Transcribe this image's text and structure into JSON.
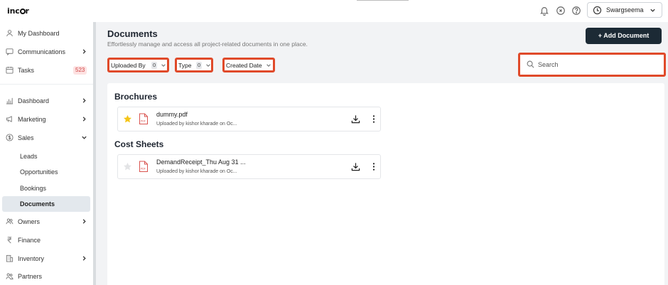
{
  "app": {
    "logo_text_left": "inc",
    "logo_text_right": "r"
  },
  "topbar": {
    "user_name": "Swargseema"
  },
  "sidebar": {
    "items": [
      {
        "label": "My Dashboard",
        "icon": "user-icon"
      },
      {
        "label": "Communications",
        "icon": "chat-icon"
      },
      {
        "label": "Tasks",
        "icon": "calendar-icon",
        "badge": "523"
      },
      {
        "label": "Dashboard",
        "icon": "bar-chart-icon"
      },
      {
        "label": "Marketing",
        "icon": "megaphone-icon"
      },
      {
        "label": "Sales",
        "icon": "currency-icon"
      },
      {
        "label": "Owners",
        "icon": "users-icon"
      },
      {
        "label": "Finance",
        "icon": "rupee-icon"
      },
      {
        "label": "Inventory",
        "icon": "building-icon"
      },
      {
        "label": "Partners",
        "icon": "partners-icon"
      }
    ],
    "sales_sub": [
      "Leads",
      "Opportunities",
      "Bookings",
      "Documents"
    ]
  },
  "main": {
    "title": "Documents",
    "subtitle": "Effortlessly manage and access all project-related documents in one place.",
    "add_button": "+ Add Document",
    "filters": {
      "uploaded_by": {
        "label": "Uploaded By",
        "count": "0"
      },
      "type": {
        "label": "Type",
        "count": "0"
      },
      "created_date": {
        "label": "Created Date"
      }
    },
    "search": {
      "placeholder": "Search"
    },
    "sections": [
      {
        "title": "Brochures",
        "docs": [
          {
            "name": "dummy.pdf",
            "meta": "Uploaded by kishor kharade on Oc...",
            "starred": true
          }
        ]
      },
      {
        "title": "Cost Sheets",
        "docs": [
          {
            "name": "DemandReceipt_Thu Aug 31 ...",
            "meta": "Uploaded by kishor kharade on Oc...",
            "starred": false
          }
        ]
      }
    ]
  },
  "colors": {
    "accent_button": "#1c2a35",
    "highlight_border": "#e04a2a",
    "star": "#f5c518",
    "pdf": "#d9534f",
    "badge_bg": "#fde2e2",
    "badge_text": "#d04545"
  }
}
